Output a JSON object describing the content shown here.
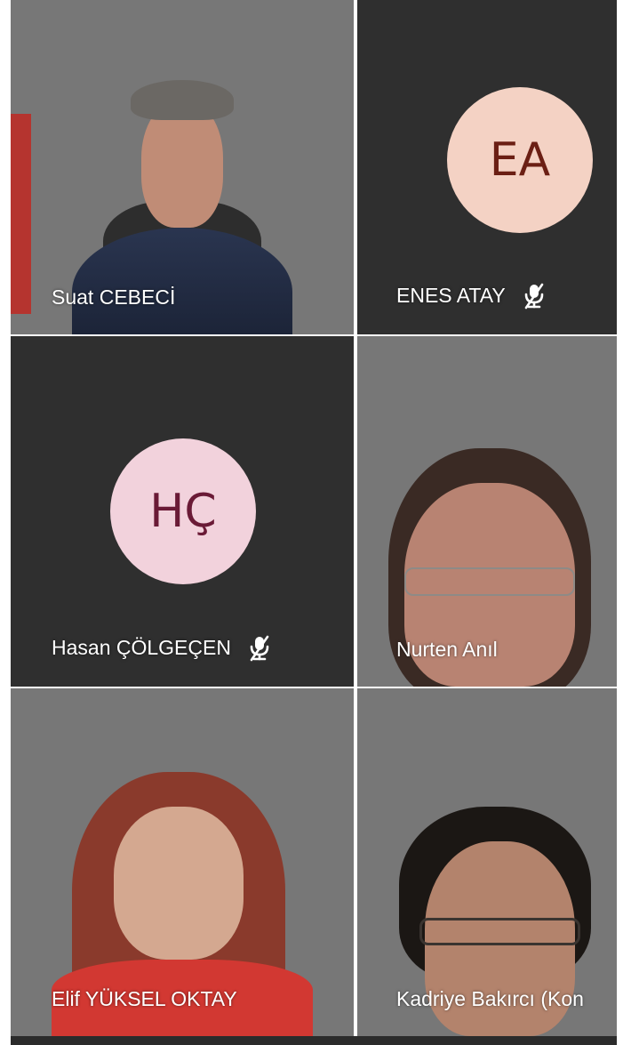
{
  "participants": [
    {
      "name": "Suat CEBECİ",
      "type": "video",
      "muted": false
    },
    {
      "name": "ENES ATAY",
      "type": "avatar",
      "initials": "EA",
      "avatar_bg": "#f4d2c4",
      "avatar_fg": "#6b1f14",
      "muted": true,
      "mic_icon": "mic-muted-icon"
    },
    {
      "name": "Hasan ÇÖLGEÇEN",
      "type": "avatar",
      "initials": "HÇ",
      "avatar_bg": "#f2d2dc",
      "avatar_fg": "#6a1a36",
      "muted": true,
      "mic_icon": "mic-muted-icon"
    },
    {
      "name": "Nurten Anıl",
      "type": "video",
      "muted": false
    },
    {
      "name": "Elif YÜKSEL OKTAY",
      "type": "video",
      "muted": false
    },
    {
      "name": "Kadriye Bakırcı (Kon",
      "type": "video",
      "muted": false
    }
  ],
  "colors": {
    "tile_bg": "#2f2f2f",
    "name_text": "#ffffff"
  }
}
